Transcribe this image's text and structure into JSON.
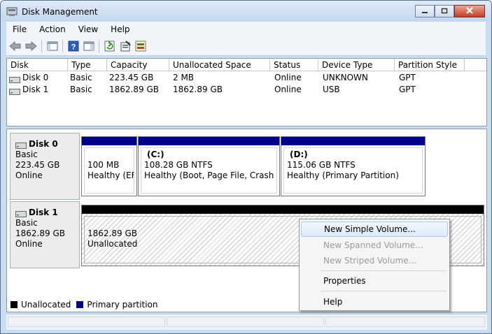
{
  "window": {
    "title": "Disk Management",
    "controls": {
      "minimize": "minimize-icon",
      "maximize": "maximize-icon",
      "close": "close-icon"
    }
  },
  "menubar": {
    "items": [
      "File",
      "Action",
      "View",
      "Help"
    ]
  },
  "toolbar": {
    "icons": [
      "back-arrow-icon",
      "forward-arrow-icon",
      "console-tree-icon",
      "help-icon",
      "action-pane-icon",
      "refresh-icon",
      "properties-icon",
      "rescan-disks-icon"
    ]
  },
  "volume_list": {
    "columns": [
      "Disk",
      "Type",
      "Capacity",
      "Unallocated Space",
      "Status",
      "Device Type",
      "Partition Style"
    ],
    "rows": [
      [
        "Disk 0",
        "Basic",
        "223.45 GB",
        "2 MB",
        "Online",
        "UNKNOWN",
        "GPT"
      ],
      [
        "Disk 1",
        "Basic",
        "1862.89 GB",
        "1862.89 GB",
        "Online",
        "USB",
        "GPT"
      ]
    ]
  },
  "disks": [
    {
      "name": "Disk 0",
      "type": "Basic",
      "size": "223.45 GB",
      "status": "Online",
      "partitions": [
        {
          "label": "",
          "line1": "100 MB",
          "line2": "Healthy (EFI"
        },
        {
          "label": "(C:)",
          "line1": "108.28 GB NTFS",
          "line2": "Healthy (Boot, Page File, Crash Dum"
        },
        {
          "label": "(D:)",
          "line1": "115.06 GB NTFS",
          "line2": "Healthy (Primary Partition)"
        }
      ]
    },
    {
      "name": "Disk 1",
      "type": "Basic",
      "size": "1862.89 GB",
      "status": "Online",
      "partitions": [
        {
          "label": "",
          "line1": "1862.89 GB",
          "line2": "Unallocated"
        }
      ]
    }
  ],
  "legend": [
    {
      "label": "Unallocated",
      "color": "#000000"
    },
    {
      "label": "Primary partition",
      "color": "#00008b"
    }
  ],
  "context_menu": {
    "items": [
      {
        "label": "New Simple Volume...",
        "enabled": true,
        "highlighted": true
      },
      {
        "label": "New Spanned Volume...",
        "enabled": false
      },
      {
        "label": "New Striped Volume...",
        "enabled": false
      },
      {
        "label": "Properties",
        "enabled": true
      },
      {
        "label": "Help",
        "enabled": true
      }
    ]
  },
  "colors": {
    "primary_partition": "#00008b",
    "unallocated": "#000000",
    "accent": "#a8c8ec"
  }
}
